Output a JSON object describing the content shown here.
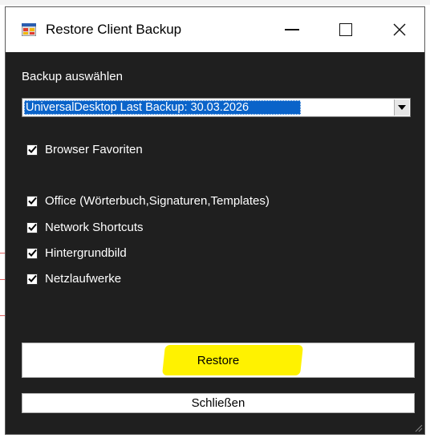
{
  "window": {
    "title": "Restore Client Backup",
    "icons": {
      "app": "app-window-icon",
      "minimize": "minimize-icon",
      "maximize": "maximize-icon",
      "close": "close-icon"
    }
  },
  "form": {
    "select_label": "Backup auswählen",
    "backup_select": {
      "selected": "UniversalDesktop Last Backup: 30.03.2026"
    },
    "options": [
      {
        "label": "Browser Favoriten",
        "checked": true
      },
      {
        "label": "Office (Wörterbuch,Signaturen,Templates)",
        "checked": true
      },
      {
        "label": "Network Shortcuts",
        "checked": true
      },
      {
        "label": "Hintergrundbild",
        "checked": true
      },
      {
        "label": "Netzlaufwerke",
        "checked": true
      }
    ],
    "restore_label": "Restore",
    "close_label": "Schließen"
  },
  "colors": {
    "window_bg": "#1f1f1f",
    "selection": "#0a63c9",
    "highlight": "#fff200"
  }
}
